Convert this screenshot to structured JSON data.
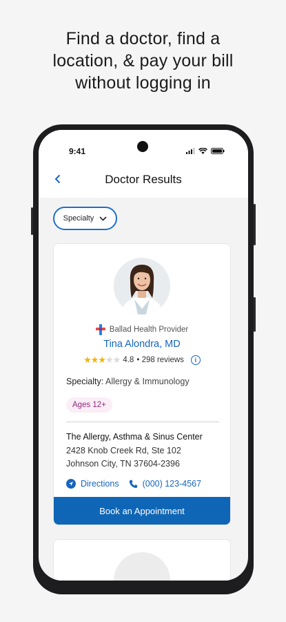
{
  "headline": {
    "line1": "Find a doctor, find a",
    "line2": "location, & pay your bill",
    "line3": "without logging in"
  },
  "status_bar": {
    "time": "9:41"
  },
  "nav": {
    "title": "Doctor Results",
    "back_icon": "chevron-left-icon"
  },
  "filter": {
    "label": "Specialty",
    "icon": "chevron-down-icon"
  },
  "doctor_card": {
    "provider_label": "Ballad Health Provider",
    "name": "Tina Alondra, MD",
    "rating": 4.8,
    "rating_text": "4.8",
    "reviews_text": "• 298 reviews",
    "specialty_label": "Specialty:",
    "specialty_value": "Allergy & Immunology",
    "age_badge": "Ages 12+",
    "location_name": "The Allergy, Asthma & Sinus Center",
    "address_line1": "2428 Knob Creek Rd, Ste 102",
    "address_line2": "Johnson City, TN 37604-2396",
    "directions_label": "Directions",
    "phone": "(000) 123-4567",
    "book_button": "Book an Appointment"
  },
  "colors": {
    "accent": "#1565c0",
    "button_bg": "#0f66b6",
    "star": "#f4b400",
    "badge_bg": "#fbeef7",
    "badge_text": "#8e2a7e"
  }
}
